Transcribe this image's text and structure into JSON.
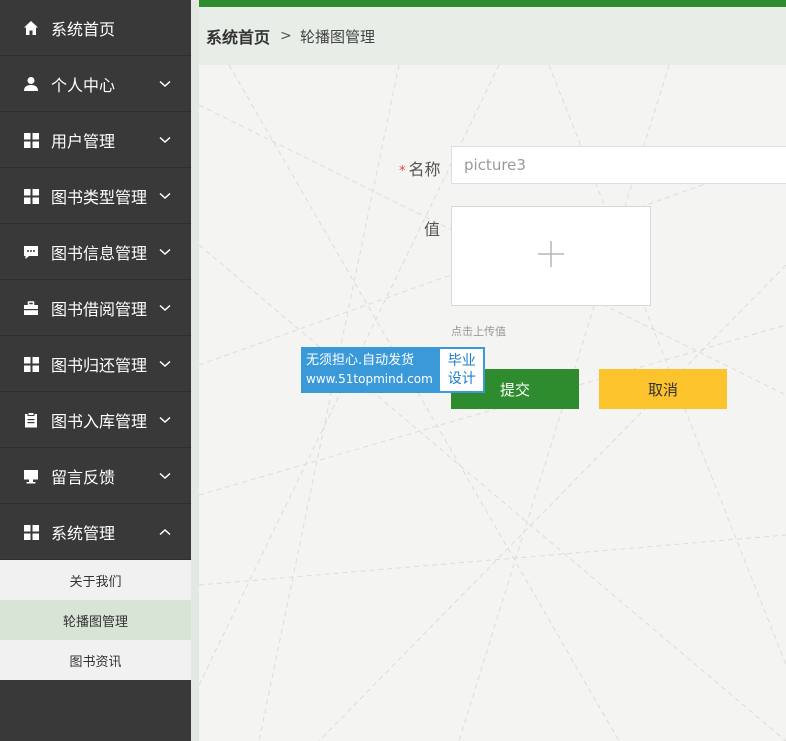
{
  "sidebar": {
    "items": [
      {
        "label": "系统首页",
        "icon": "home-icon"
      },
      {
        "label": "个人中心",
        "icon": "user-icon",
        "chevron": "down"
      },
      {
        "label": "用户管理",
        "icon": "grid-icon",
        "chevron": "down"
      },
      {
        "label": "图书类型管理",
        "icon": "grid-icon",
        "chevron": "down"
      },
      {
        "label": "图书信息管理",
        "icon": "chat-icon",
        "chevron": "down"
      },
      {
        "label": "图书借阅管理",
        "icon": "briefcase-icon",
        "chevron": "down"
      },
      {
        "label": "图书归还管理",
        "icon": "grid-icon",
        "chevron": "down"
      },
      {
        "label": "图书入库管理",
        "icon": "clipboard-icon",
        "chevron": "down"
      },
      {
        "label": "留言反馈",
        "icon": "monitor-icon",
        "chevron": "down"
      },
      {
        "label": "系统管理",
        "icon": "grid-icon",
        "chevron": "up"
      }
    ],
    "submenu": [
      {
        "label": "关于我们",
        "active": false
      },
      {
        "label": "轮播图管理",
        "active": true
      },
      {
        "label": "图书资讯",
        "active": false
      }
    ]
  },
  "breadcrumb": {
    "home": "系统首页",
    "separator": ">",
    "current": "轮播图管理"
  },
  "form": {
    "name_label": "名称",
    "required_mark": "*",
    "name_value": "picture3",
    "value_label": "值",
    "upload_hint": "点击上传值",
    "submit_label": "提交",
    "cancel_label": "取消"
  },
  "watermark": {
    "line1": "无须担心.自动发货",
    "line2": "www.51topmind.com",
    "badge1": "毕业",
    "badge2": "设计"
  },
  "colors": {
    "sidebar_bg": "#393939",
    "accent_green": "#2e8b2e",
    "cancel_yellow": "#fcc32c",
    "active_submenu": "#d8e4d6"
  }
}
